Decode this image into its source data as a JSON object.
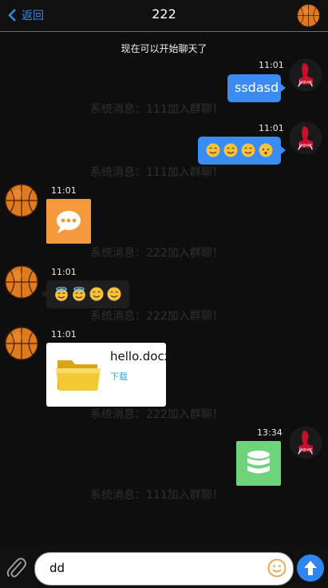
{
  "header": {
    "back_label": "返回",
    "title": "222"
  },
  "system_top": "现在可以开始聊天了",
  "messages": [
    {
      "time": "11:01",
      "text": "ssdasd"
    },
    {
      "time": "11:01"
    },
    {
      "time": "11:01"
    },
    {
      "time": "11:01"
    },
    {
      "time": "11:01",
      "file_name": "hello.docx",
      "download_label": "下载"
    },
    {
      "time": "13:34"
    }
  ],
  "join_notices": [
    "系统消息：111加入群聊！",
    "系统消息：111加入群聊！",
    "系统消息：222加入群聊！",
    "系统消息：222加入群聊！",
    "系统消息：222加入群聊！",
    "系统消息：111加入群聊！"
  ],
  "composer": {
    "input_value": "dd"
  },
  "colors": {
    "accent": "#2f86ee",
    "bubble": "#3a8cf3",
    "background": "#0e0e0e"
  },
  "icons": [
    "chevron-left-icon",
    "paperclip-icon",
    "smile-icon",
    "send-arrow-icon",
    "chat-icon",
    "folder-icon",
    "database-icon"
  ]
}
